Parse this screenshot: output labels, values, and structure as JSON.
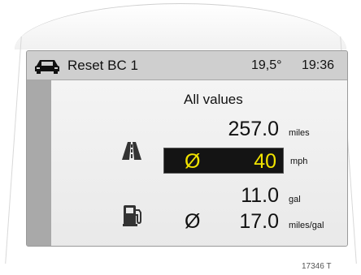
{
  "header": {
    "title": "Reset BC 1",
    "temperature": "19,5°",
    "time": "19:36"
  },
  "main": {
    "subtitle": "All values",
    "distance": {
      "value": "257.0",
      "unit": "miles"
    },
    "speed": {
      "avg_symbol": "Ø",
      "value": "40",
      "unit": "mph"
    },
    "fuel": {
      "value": "11.0",
      "unit": "gal"
    },
    "consumption": {
      "avg_symbol": "Ø",
      "value": "17.0",
      "unit": "miles/gal"
    }
  },
  "icons": {
    "car": "car-icon",
    "road": "road-icon",
    "fuel": "fuel-pump-icon"
  },
  "colors": {
    "highlight_text": "#f1e300",
    "highlight_background": "#141414"
  },
  "figure_code": "17346 T"
}
